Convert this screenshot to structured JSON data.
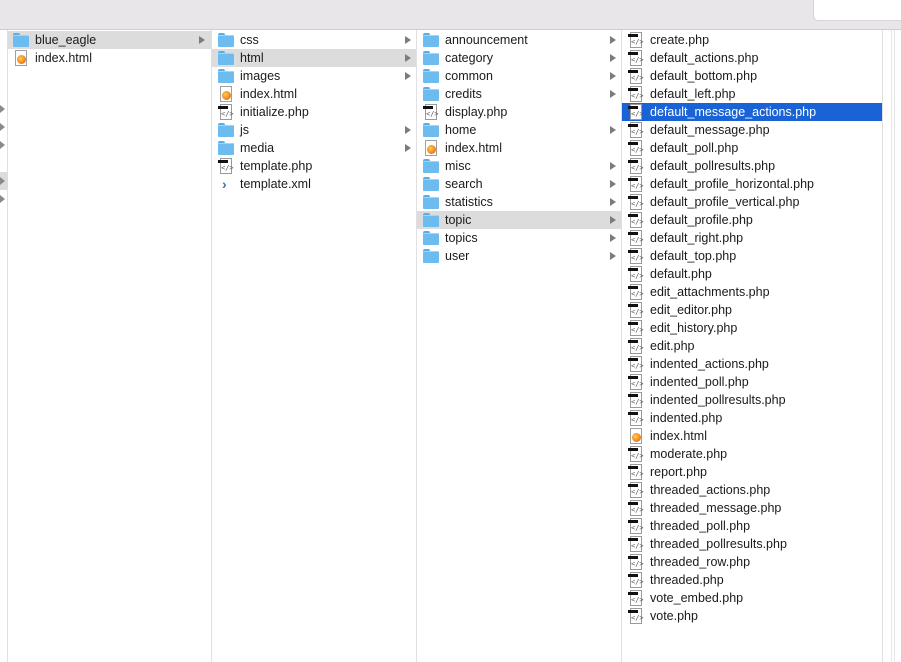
{
  "columns": [
    {
      "items": [
        {
          "name": "blue_eagle",
          "kind": "folder",
          "arrow": true,
          "state": "path"
        },
        {
          "name": "index.html",
          "kind": "html",
          "arrow": false,
          "state": ""
        }
      ]
    },
    {
      "items": [
        {
          "name": "css",
          "kind": "folder",
          "arrow": true,
          "state": ""
        },
        {
          "name": "html",
          "kind": "folder",
          "arrow": true,
          "state": "path"
        },
        {
          "name": "images",
          "kind": "folder",
          "arrow": true,
          "state": ""
        },
        {
          "name": "index.html",
          "kind": "html",
          "arrow": false,
          "state": ""
        },
        {
          "name": "initialize.php",
          "kind": "code",
          "arrow": false,
          "state": ""
        },
        {
          "name": "js",
          "kind": "folder",
          "arrow": true,
          "state": ""
        },
        {
          "name": "media",
          "kind": "folder",
          "arrow": true,
          "state": ""
        },
        {
          "name": "template.php",
          "kind": "code",
          "arrow": false,
          "state": ""
        },
        {
          "name": "template.xml",
          "kind": "xml",
          "arrow": false,
          "state": ""
        }
      ]
    },
    {
      "items": [
        {
          "name": "announcement",
          "kind": "folder",
          "arrow": true,
          "state": ""
        },
        {
          "name": "category",
          "kind": "folder",
          "arrow": true,
          "state": ""
        },
        {
          "name": "common",
          "kind": "folder",
          "arrow": true,
          "state": ""
        },
        {
          "name": "credits",
          "kind": "folder",
          "arrow": true,
          "state": ""
        },
        {
          "name": "display.php",
          "kind": "code",
          "arrow": false,
          "state": ""
        },
        {
          "name": "home",
          "kind": "folder",
          "arrow": true,
          "state": ""
        },
        {
          "name": "index.html",
          "kind": "html",
          "arrow": false,
          "state": ""
        },
        {
          "name": "misc",
          "kind": "folder",
          "arrow": true,
          "state": ""
        },
        {
          "name": "search",
          "kind": "folder",
          "arrow": true,
          "state": ""
        },
        {
          "name": "statistics",
          "kind": "folder",
          "arrow": true,
          "state": ""
        },
        {
          "name": "topic",
          "kind": "folder",
          "arrow": true,
          "state": "path"
        },
        {
          "name": "topics",
          "kind": "folder",
          "arrow": true,
          "state": ""
        },
        {
          "name": "user",
          "kind": "folder",
          "arrow": true,
          "state": ""
        }
      ]
    },
    {
      "items": [
        {
          "name": "create.php",
          "kind": "code",
          "arrow": false,
          "state": ""
        },
        {
          "name": "default_actions.php",
          "kind": "code",
          "arrow": false,
          "state": ""
        },
        {
          "name": "default_bottom.php",
          "kind": "code",
          "arrow": false,
          "state": ""
        },
        {
          "name": "default_left.php",
          "kind": "code",
          "arrow": false,
          "state": ""
        },
        {
          "name": "default_message_actions.php",
          "kind": "code",
          "arrow": false,
          "state": "selected"
        },
        {
          "name": "default_message.php",
          "kind": "code",
          "arrow": false,
          "state": ""
        },
        {
          "name": "default_poll.php",
          "kind": "code",
          "arrow": false,
          "state": ""
        },
        {
          "name": "default_pollresults.php",
          "kind": "code",
          "arrow": false,
          "state": ""
        },
        {
          "name": "default_profile_horizontal.php",
          "kind": "code",
          "arrow": false,
          "state": ""
        },
        {
          "name": "default_profile_vertical.php",
          "kind": "code",
          "arrow": false,
          "state": ""
        },
        {
          "name": "default_profile.php",
          "kind": "code",
          "arrow": false,
          "state": ""
        },
        {
          "name": "default_right.php",
          "kind": "code",
          "arrow": false,
          "state": ""
        },
        {
          "name": "default_top.php",
          "kind": "code",
          "arrow": false,
          "state": ""
        },
        {
          "name": "default.php",
          "kind": "code",
          "arrow": false,
          "state": ""
        },
        {
          "name": "edit_attachments.php",
          "kind": "code",
          "arrow": false,
          "state": ""
        },
        {
          "name": "edit_editor.php",
          "kind": "code",
          "arrow": false,
          "state": ""
        },
        {
          "name": "edit_history.php",
          "kind": "code",
          "arrow": false,
          "state": ""
        },
        {
          "name": "edit.php",
          "kind": "code",
          "arrow": false,
          "state": ""
        },
        {
          "name": "indented_actions.php",
          "kind": "code",
          "arrow": false,
          "state": ""
        },
        {
          "name": "indented_poll.php",
          "kind": "code",
          "arrow": false,
          "state": ""
        },
        {
          "name": "indented_pollresults.php",
          "kind": "code",
          "arrow": false,
          "state": ""
        },
        {
          "name": "indented.php",
          "kind": "code",
          "arrow": false,
          "state": ""
        },
        {
          "name": "index.html",
          "kind": "html",
          "arrow": false,
          "state": ""
        },
        {
          "name": "moderate.php",
          "kind": "code",
          "arrow": false,
          "state": ""
        },
        {
          "name": "report.php",
          "kind": "code",
          "arrow": false,
          "state": ""
        },
        {
          "name": "threaded_actions.php",
          "kind": "code",
          "arrow": false,
          "state": ""
        },
        {
          "name": "threaded_message.php",
          "kind": "code",
          "arrow": false,
          "state": ""
        },
        {
          "name": "threaded_poll.php",
          "kind": "code",
          "arrow": false,
          "state": ""
        },
        {
          "name": "threaded_pollresults.php",
          "kind": "code",
          "arrow": false,
          "state": ""
        },
        {
          "name": "threaded_row.php",
          "kind": "code",
          "arrow": false,
          "state": ""
        },
        {
          "name": "threaded.php",
          "kind": "code",
          "arrow": false,
          "state": ""
        },
        {
          "name": "vote_embed.php",
          "kind": "code",
          "arrow": false,
          "state": ""
        },
        {
          "name": "vote.php",
          "kind": "code",
          "arrow": false,
          "state": ""
        }
      ]
    }
  ],
  "colors": {
    "selection": "#1a63d6",
    "path_highlight": "#dcdcdc",
    "folder": "#6cbcf0",
    "toolbar": "#e8e6e8"
  }
}
